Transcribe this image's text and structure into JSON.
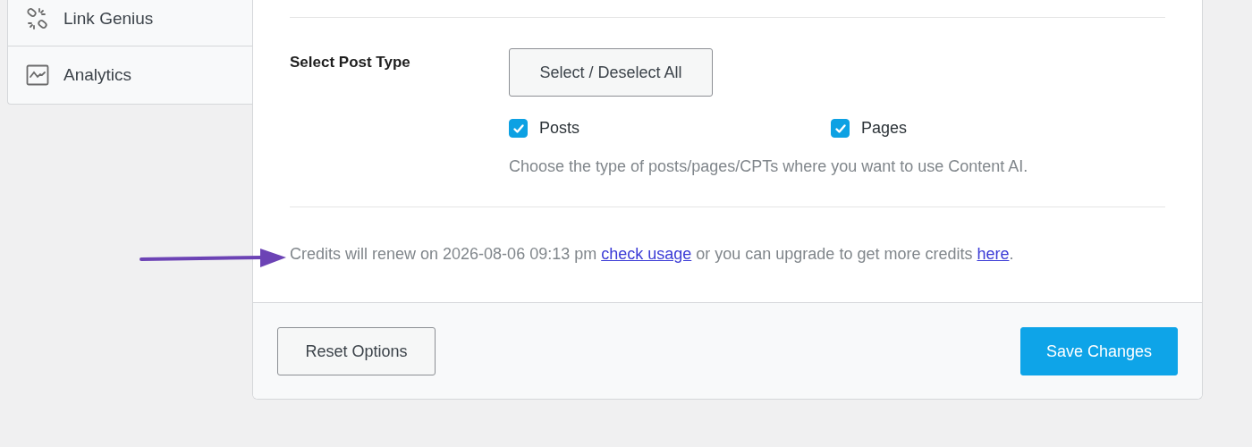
{
  "sidebar": {
    "items": [
      {
        "label": "Link Genius"
      },
      {
        "label": "Analytics"
      }
    ]
  },
  "settings": {
    "label": "Select Post Type",
    "toggle_button": "Select / Deselect All",
    "options": [
      {
        "label": "Posts",
        "checked": true
      },
      {
        "label": "Pages",
        "checked": true
      }
    ],
    "description": "Choose the type of posts/pages/CPTs where you want to use Content AI."
  },
  "credits": [
    {
      "kind": "text",
      "text": "Credits will renew on 2026-08-06 09:13 pm "
    },
    {
      "kind": "link",
      "text": "check usage"
    },
    {
      "kind": "text",
      "text": " or you can upgrade to get more credits "
    },
    {
      "kind": "link",
      "text": "here"
    },
    {
      "kind": "text",
      "text": "."
    }
  ],
  "footer": {
    "reset_button": "Reset Options",
    "save_button": "Save Changes"
  }
}
